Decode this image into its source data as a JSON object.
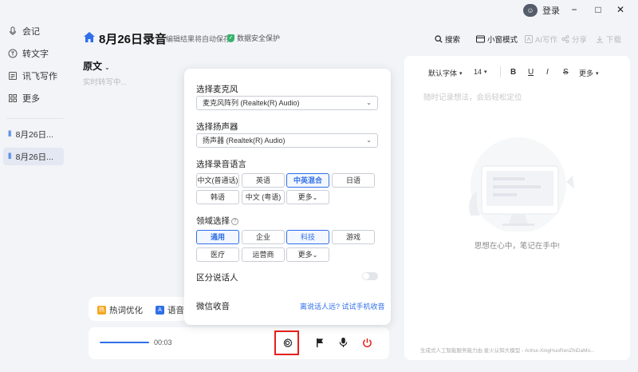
{
  "window": {
    "login_label": "登录",
    "minimize": "−",
    "maximize": "□",
    "close": "✕"
  },
  "sidebar": {
    "items": [
      {
        "label": "会记",
        "icon": "microphone-icon"
      },
      {
        "label": "转文字",
        "icon": "transcribe-icon"
      },
      {
        "label": "讯飞写作",
        "icon": "document-icon"
      },
      {
        "label": "更多",
        "icon": "grid-icon"
      }
    ],
    "recordings": [
      {
        "label": "8月26日...",
        "active": false
      },
      {
        "label": "8月26日...",
        "active": true
      }
    ]
  },
  "header": {
    "title": "8月26日录音",
    "hint": "编辑结果将自动保存",
    "safety": "数据安全保护",
    "search": "搜索",
    "mini_window": "小窗模式",
    "ai_write": "AI写作",
    "share": "分享",
    "download": "下载"
  },
  "left": {
    "original_tab": "原文",
    "realtime": "实时转写中...",
    "hotword": "热词优化",
    "language_chip": "语音"
  },
  "player": {
    "time": "00:03",
    "progress": 0.33
  },
  "popup": {
    "mic_label": "选择麦克风",
    "mic_value": "麦克风阵列 (Realtek(R) Audio)",
    "speaker_label": "选择扬声器",
    "speaker_value": "扬声器 (Realtek(R) Audio)",
    "language_label": "选择录音语言",
    "languages": [
      "中文(普通话)",
      "英语",
      "中英混合",
      "日语",
      "韩语",
      "中文 (粤语)",
      "更多"
    ],
    "languages_selected": "中英混合",
    "domain_label": "领域选择",
    "domains": [
      "通用",
      "企业",
      "科技",
      "游戏",
      "医疗",
      "运营商",
      "更多"
    ],
    "domains_selected": [
      "通用",
      "科技"
    ],
    "speaker_diarization_label": "区分说话人",
    "speaker_diarization_on": false,
    "wechat_label": "微信收音",
    "wechat_link": "离说话人远? 试试手机收音"
  },
  "right": {
    "font_label": "默认字体",
    "font_size": "14",
    "bold": "B",
    "underline": "U",
    "italic": "I",
    "strike": "S",
    "more": "更多",
    "placeholder": "随时记录想法，会后轻松定位",
    "slogan": "思想在心中，笔记在手中!",
    "footer": "生成式人工智能服务能力由 星火认知大模型 - Anhui-XingHuoRenZhiDaMo..."
  },
  "colors": {
    "accent": "#2f6fe8",
    "danger": "#e5201c",
    "safe_green": "#35b26b"
  }
}
